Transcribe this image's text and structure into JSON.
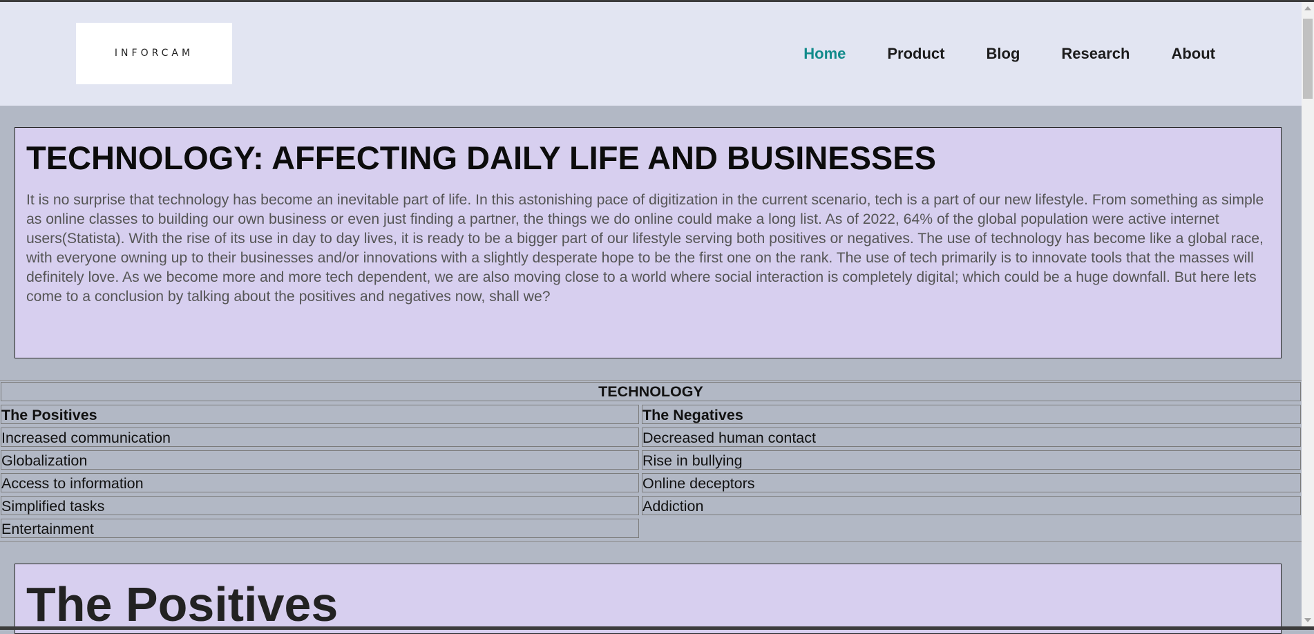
{
  "header": {
    "logo_text": "INFORCAM",
    "nav": [
      {
        "label": "Home",
        "active": true
      },
      {
        "label": "Product",
        "active": false
      },
      {
        "label": "Blog",
        "active": false
      },
      {
        "label": "Research",
        "active": false
      },
      {
        "label": "About",
        "active": false
      }
    ],
    "active_color": "#128b8b"
  },
  "intro": {
    "title": "TECHNOLOGY: AFFECTING DAILY LIFE AND BUSINESSES",
    "body": "It is no surprise that technology has become an inevitable part of life. In this astonishing pace of digitization in the current scenario, tech is a part of our new lifestyle. From something as simple as online classes to building our own business or even just finding a partner, the things we do online could make a long list. As of 2022, 64% of the global population were active internet users(Statista). With the rise of its use in day to day lives, it is ready to be a bigger part of our lifestyle serving both positives or negatives. The use of technology has become like a global race, with everyone owning up to their businesses and/or innovations with a slightly desperate hope to be the first one on the rank. The use of tech primarily is to innovate tools that the masses will definitely love. As we become more and more tech dependent, we are also moving close to a world where social interaction is completely digital; which could be a huge downfall. But here lets come to a conclusion by talking about the positives and negatives now, shall we?"
  },
  "table": {
    "caption": "TECHNOLOGY",
    "headers": [
      "The Positives",
      "The Negatives"
    ],
    "rows": [
      [
        "Increased communication",
        "Decreased human contact"
      ],
      [
        "Globalization",
        "Rise in bullying"
      ],
      [
        "Access to information",
        "Online deceptors"
      ],
      [
        "Simplified tasks",
        "Addiction"
      ],
      [
        "Entertainment",
        ""
      ]
    ]
  },
  "positives_section": {
    "title": "The Positives"
  }
}
